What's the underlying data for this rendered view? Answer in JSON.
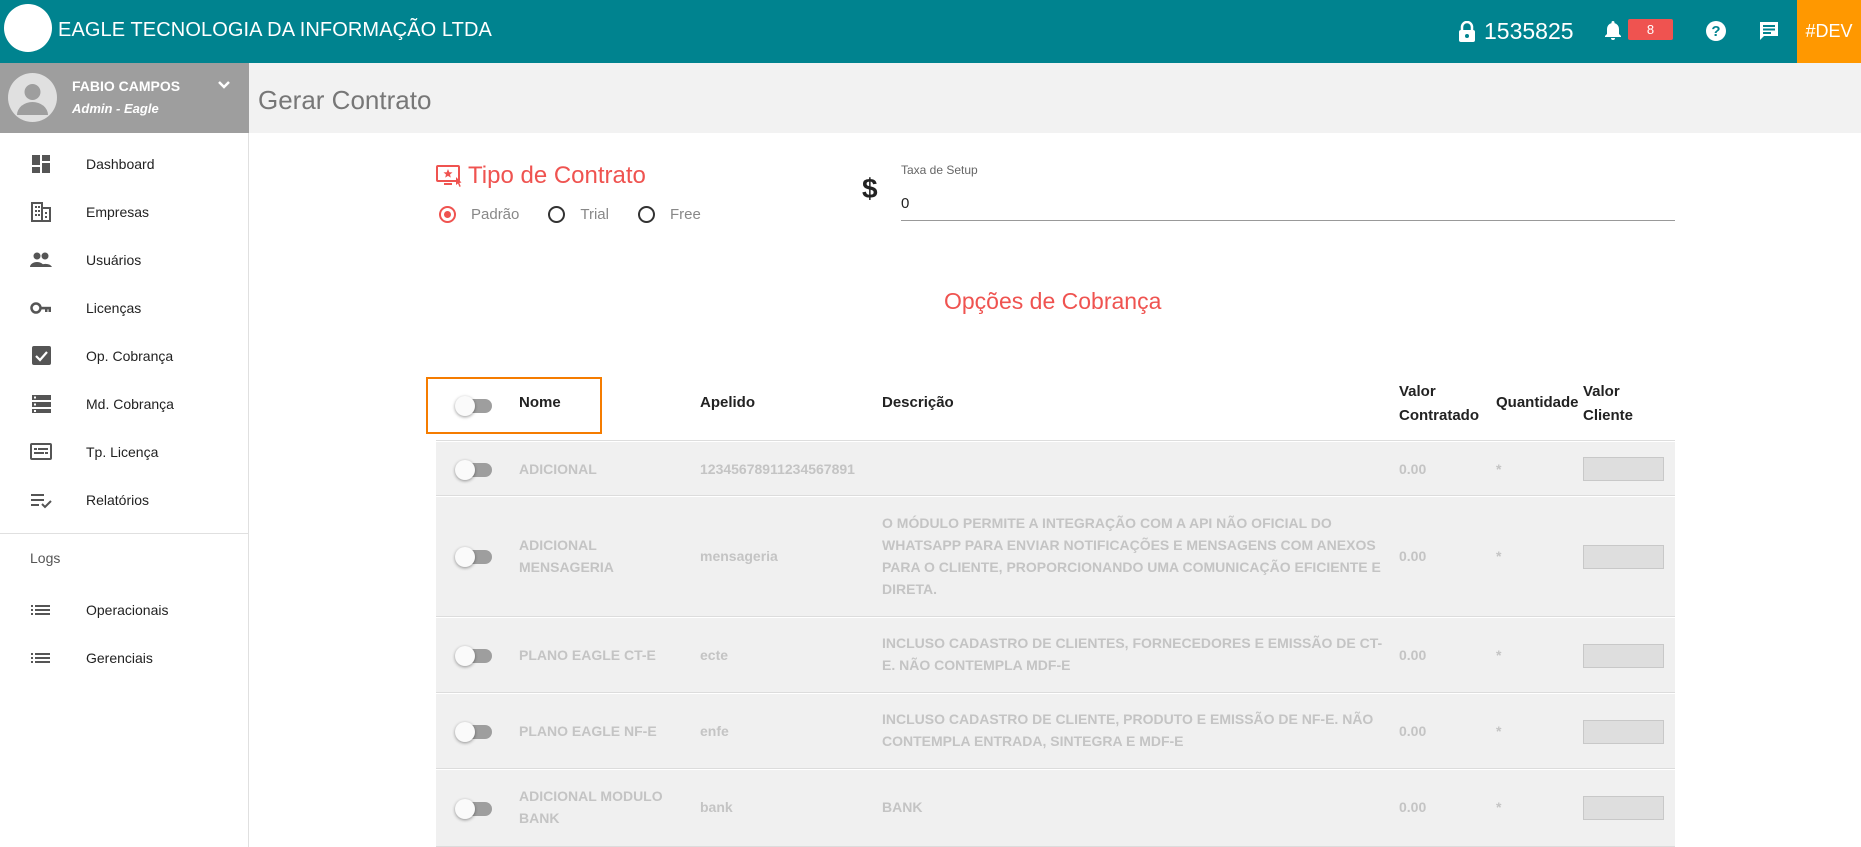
{
  "topbar": {
    "company": "EAGLE TECNOLOGIA DA INFORMAÇÃO LTDA",
    "license_number": "1535825",
    "notifications_count": "8",
    "env_tag": "#DEV"
  },
  "user": {
    "name": "FABIO CAMPOS",
    "role": "Admin - Eagle"
  },
  "sidebar": {
    "items": [
      {
        "label": "Dashboard",
        "icon": "dashboard-icon"
      },
      {
        "label": "Empresas",
        "icon": "building-icon"
      },
      {
        "label": "Usuários",
        "icon": "people-icon"
      },
      {
        "label": "Licenças",
        "icon": "key-icon"
      },
      {
        "label": "Op. Cobrança",
        "icon": "checkbox-icon"
      },
      {
        "label": "Md. Cobrança",
        "icon": "storage-icon"
      },
      {
        "label": "Tp. Licença",
        "icon": "subtitles-icon"
      },
      {
        "label": "Relatórios",
        "icon": "playlist-check-icon"
      }
    ],
    "logs_label": "Logs",
    "logs_items": [
      {
        "label": "Operacionais",
        "icon": "list-icon"
      },
      {
        "label": "Gerenciais",
        "icon": "list-icon"
      }
    ]
  },
  "page": {
    "title": "Gerar Contrato"
  },
  "contract": {
    "title": "Tipo de Contrato",
    "options": [
      "Padrão",
      "Trial",
      "Free"
    ],
    "selected": "Padrão",
    "setup_label": "Taxa de Setup",
    "setup_value": "0"
  },
  "billing": {
    "title": "Opções de Cobrança",
    "columns": {
      "nome": "Nome",
      "apelido": "Apelido",
      "descricao": "Descrição",
      "valor_contratado_1": "Valor",
      "valor_contratado_2": "Contratado",
      "quantidade": "Quantidade",
      "valor_cliente_1": "Valor",
      "valor_cliente_2": "Cliente"
    },
    "rows": [
      {
        "nome": "ADICIONAL",
        "apelido": "12345678911234567891",
        "descricao": "",
        "valor": "0.00",
        "quantidade": "*"
      },
      {
        "nome": "ADICIONAL MENSAGERIA",
        "apelido": "mensageria",
        "descricao": "O MÓDULO PERMITE A INTEGRAÇÃO COM A API NÃO OFICIAL DO WHATSAPP PARA ENVIAR NOTIFICAÇÕES E MENSAGENS COM ANEXOS PARA O CLIENTE, PROPORCIONANDO UMA COMUNICAÇÃO EFICIENTE E DIRETA.",
        "valor": "0.00",
        "quantidade": "*"
      },
      {
        "nome": "PLANO EAGLE CT-E",
        "apelido": "ecte",
        "descricao": "INCLUSO CADASTRO DE CLIENTES, FORNECEDORES E EMISSÃO DE CT-E. NÃO CONTEMPLA MDF-E",
        "valor": "0.00",
        "quantidade": "*"
      },
      {
        "nome": "PLANO EAGLE NF-E",
        "apelido": "enfe",
        "descricao": "INCLUSO CADASTRO DE CLIENTE, PRODUTO E EMISSÃO DE NF-E. NÃO CONTEMPLA ENTRADA, SINTEGRA E MDF-E",
        "valor": "0.00",
        "quantidade": "*"
      },
      {
        "nome": "ADICIONAL MODULO BANK",
        "apelido": "bank",
        "descricao": "BANK",
        "valor": "0.00",
        "quantidade": "*"
      }
    ]
  },
  "colors": {
    "topbar": "#00838f",
    "accent": "#ef5350",
    "dev": "#ff9800",
    "highlight": "#f57c00"
  }
}
